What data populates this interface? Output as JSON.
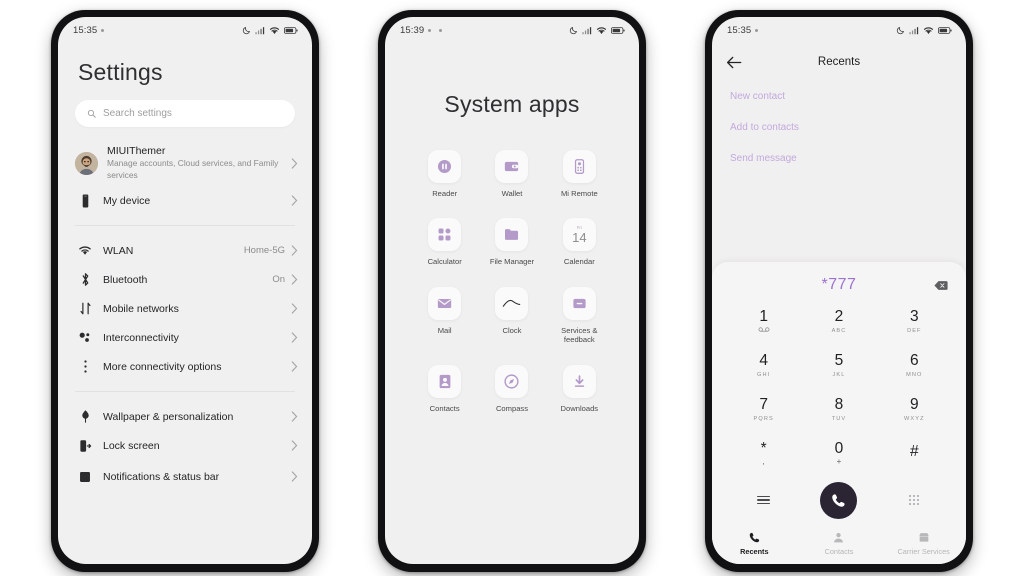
{
  "colors": {
    "accent_purple": "#b39ac9",
    "link_purple": "#c3a9dd",
    "dial_number": "#9d72cf",
    "screen_bg": "#f1f0f0",
    "frame": "#111113"
  },
  "phone1": {
    "status": {
      "time": "15:35",
      "icons": [
        "dnd-moon-icon",
        "signal-icon",
        "wifi-icon",
        "battery-icon"
      ]
    },
    "title": "Settings",
    "search": {
      "placeholder": "Search settings",
      "icon": "search-icon"
    },
    "account": {
      "name": "MIUIThemer",
      "subtitle": "Manage accounts, Cloud services, and Family services",
      "avatar": "user-avatar"
    },
    "groups": [
      {
        "items": [
          {
            "label": "My device",
            "value": "",
            "icon": "phone-device-icon"
          }
        ]
      },
      {
        "items": [
          {
            "label": "WLAN",
            "value": "Home-5G",
            "icon": "wifi-icon"
          },
          {
            "label": "Bluetooth",
            "value": "On",
            "icon": "bluetooth-icon"
          },
          {
            "label": "Mobile networks",
            "value": "",
            "icon": "mobile-network-icon"
          },
          {
            "label": "Interconnectivity",
            "value": "",
            "icon": "interconnectivity-icon"
          },
          {
            "label": "More connectivity options",
            "value": "",
            "icon": "more-vertical-icon"
          }
        ]
      },
      {
        "items": [
          {
            "label": "Wallpaper & personalization",
            "value": "",
            "icon": "wallpaper-icon"
          },
          {
            "label": "Lock screen",
            "value": "",
            "icon": "lock-screen-icon"
          },
          {
            "label": "Notifications & status bar",
            "value": "",
            "icon": "notifications-icon"
          }
        ]
      }
    ]
  },
  "phone2": {
    "status": {
      "time": "15:39",
      "icons": [
        "dnd-moon-icon",
        "signal-icon",
        "wifi-icon",
        "battery-icon"
      ]
    },
    "title": "System apps",
    "apps": [
      {
        "name": "Reader",
        "icon": "reader-icon"
      },
      {
        "name": "Wallet",
        "icon": "wallet-icon"
      },
      {
        "name": "Mi Remote",
        "icon": "mi-remote-icon"
      },
      {
        "name": "Calculator",
        "icon": "calculator-icon"
      },
      {
        "name": "File Manager",
        "icon": "folder-icon"
      },
      {
        "name": "Calendar",
        "icon": "calendar-icon",
        "calendar_weekday": "Fri",
        "calendar_day": "14"
      },
      {
        "name": "Mail",
        "icon": "mail-icon"
      },
      {
        "name": "Clock",
        "icon": "clock-icon"
      },
      {
        "name": "Services & feedback",
        "icon": "services-feedback-icon"
      },
      {
        "name": "Contacts",
        "icon": "contacts-icon"
      },
      {
        "name": "Compass",
        "icon": "compass-icon"
      },
      {
        "name": "Downloads",
        "icon": "download-icon"
      }
    ]
  },
  "phone3": {
    "status": {
      "time": "15:35",
      "icons": [
        "dnd-moon-icon",
        "signal-icon",
        "wifi-icon",
        "battery-icon"
      ]
    },
    "topbar": {
      "title": "Recents",
      "back_icon": "arrow-left-icon"
    },
    "links": [
      "New contact",
      "Add to contacts",
      "Send message"
    ],
    "dialer": {
      "number": "*777",
      "delete_icon": "backspace-icon",
      "keys": [
        {
          "digit": "1",
          "sub": "voicemail-icon",
          "sub_type": "icon"
        },
        {
          "digit": "2",
          "sub": "ABC",
          "sub_type": "text"
        },
        {
          "digit": "3",
          "sub": "DEF",
          "sub_type": "text"
        },
        {
          "digit": "4",
          "sub": "GHI",
          "sub_type": "text"
        },
        {
          "digit": "5",
          "sub": "JKL",
          "sub_type": "text"
        },
        {
          "digit": "6",
          "sub": "MNO",
          "sub_type": "text"
        },
        {
          "digit": "7",
          "sub": "PQRS",
          "sub_type": "text"
        },
        {
          "digit": "8",
          "sub": "TUV",
          "sub_type": "text"
        },
        {
          "digit": "9",
          "sub": "WXYZ",
          "sub_type": "text"
        },
        {
          "digit": "*",
          "sub": ",",
          "sub_type": "sym"
        },
        {
          "digit": "0",
          "sub": "+",
          "sub_type": "sym"
        },
        {
          "digit": "#",
          "sub": "",
          "sub_type": "text"
        }
      ],
      "actions": {
        "menu_icon": "menu-icon",
        "call_icon": "call-icon",
        "keypad_icon": "keypad-icon"
      }
    },
    "bottomnav": [
      {
        "label": "Recents",
        "icon": "phone-recents-icon",
        "active": true
      },
      {
        "label": "Contacts",
        "icon": "contacts-person-icon",
        "active": false
      },
      {
        "label": "Carrier Services",
        "icon": "carrier-services-icon",
        "active": false
      }
    ]
  }
}
